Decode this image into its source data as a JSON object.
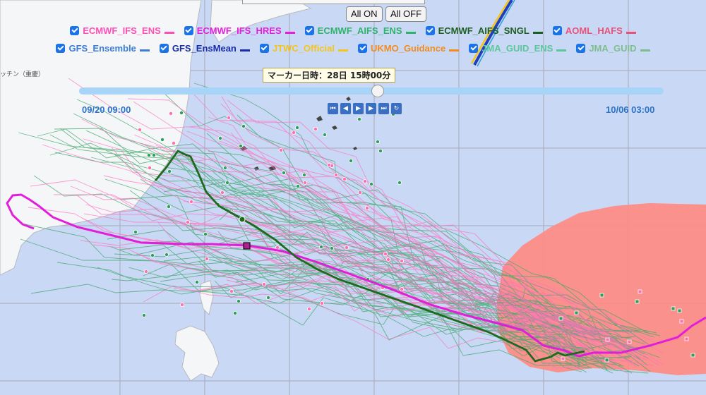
{
  "controls": {
    "all_on": "All ON",
    "all_off": "All OFF"
  },
  "legend": [
    [
      {
        "label": "ECMWF_IFS_ENS",
        "color": "#ff4fb6"
      },
      {
        "label": "ECMWF_IFS_HRES",
        "color": "#e61edc"
      },
      {
        "label": "ECMWF_AIFS_ENS",
        "color": "#2eb36b"
      },
      {
        "label": "ECMWF_AIFS_SNGL",
        "color": "#1b5e20"
      },
      {
        "label": "AOML_HAFS",
        "color": "#e8517a"
      }
    ],
    [
      {
        "label": "GFS_Ensemble",
        "color": "#3b7dd8"
      },
      {
        "label": "GFS_EnsMean",
        "color": "#1a2ea8"
      },
      {
        "label": "JTWC_Official",
        "color": "#f5c518"
      },
      {
        "label": "UKMO_Guidance",
        "color": "#f28c1e"
      },
      {
        "label": "JMA_GUID_ENS",
        "color": "#5bc79a"
      },
      {
        "label": "JMA_GUID",
        "color": "#7dbf8c"
      }
    ]
  ],
  "marker_time": "マーカー日時：28日 15時00分",
  "timeline": {
    "start": "09/20 09:00",
    "end": "10/06 03:00",
    "position": 0.51
  },
  "playback": [
    "first",
    "prev",
    "play",
    "next",
    "last",
    "loop"
  ],
  "map_labels": {
    "region_left": "ッチン（重慶）"
  },
  "colors": {
    "land": "#f4f5f7",
    "ocean": "#c9d8f5",
    "wind_area": "#ff8b82"
  }
}
